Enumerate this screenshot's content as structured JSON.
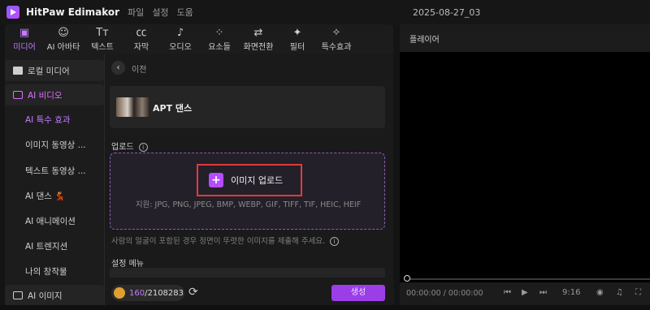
{
  "app": {
    "name": "HitPaw Edimakor",
    "menu": [
      "파일",
      "설정",
      "도움"
    ],
    "project_title": "2025-08-27_03"
  },
  "toolbar": {
    "tabs": [
      {
        "label": "미디어",
        "icon": "media-icon",
        "glyph": "▣",
        "active": true
      },
      {
        "label": "AI 아바타",
        "icon": "avatar-icon",
        "glyph": "☺"
      },
      {
        "label": "텍스트",
        "icon": "text-icon",
        "glyph": "Tт"
      },
      {
        "label": "자막",
        "icon": "caption-icon",
        "glyph": "㏄"
      },
      {
        "label": "오디오",
        "icon": "audio-icon",
        "glyph": "♪"
      },
      {
        "label": "요소들",
        "icon": "elements-icon",
        "glyph": "⁘"
      },
      {
        "label": "화면전환",
        "icon": "transition-icon",
        "glyph": "⇄"
      },
      {
        "label": "필터",
        "icon": "filter-icon",
        "glyph": "✦"
      },
      {
        "label": "특수효과",
        "icon": "effects-icon",
        "glyph": "✧"
      }
    ]
  },
  "sidebar": {
    "local_media": "로컬 미디어",
    "ai_video": "AI 비디오",
    "items": [
      "AI 특수 효과",
      "이미지 동영상 ...",
      "텍스트 동영상 ...",
      "AI 댄스 💃",
      "AI 애니메이션",
      "AI 트렌지션",
      "나의 창작물"
    ],
    "ai_image": "AI 이미지"
  },
  "main": {
    "back_label": "이전",
    "card_title": "APT 댄스",
    "upload_section": "업로드",
    "upload_button": "이미지 업로드",
    "formats": "지원: JPG, PNG, JPEG, BMP, WEBP, GIF, TIFF, TIF, HEIC, HEIF",
    "hint": "사람의 얼굴이 포함된 경우 정면이 뚜렷한 이미지를 제출해 주세요.",
    "settings_section": "설정 메뉴",
    "credits_current": "160",
    "credits_total": "/2108283",
    "generate_button": "생성"
  },
  "player": {
    "title": "플레이어",
    "time": "00:00:00 / 00:00:00",
    "aspect_ratio": "9:16"
  },
  "colors": {
    "accent": "#c37bff",
    "highlight_border": "#e03a3a",
    "generate": "#9b3ee8"
  }
}
